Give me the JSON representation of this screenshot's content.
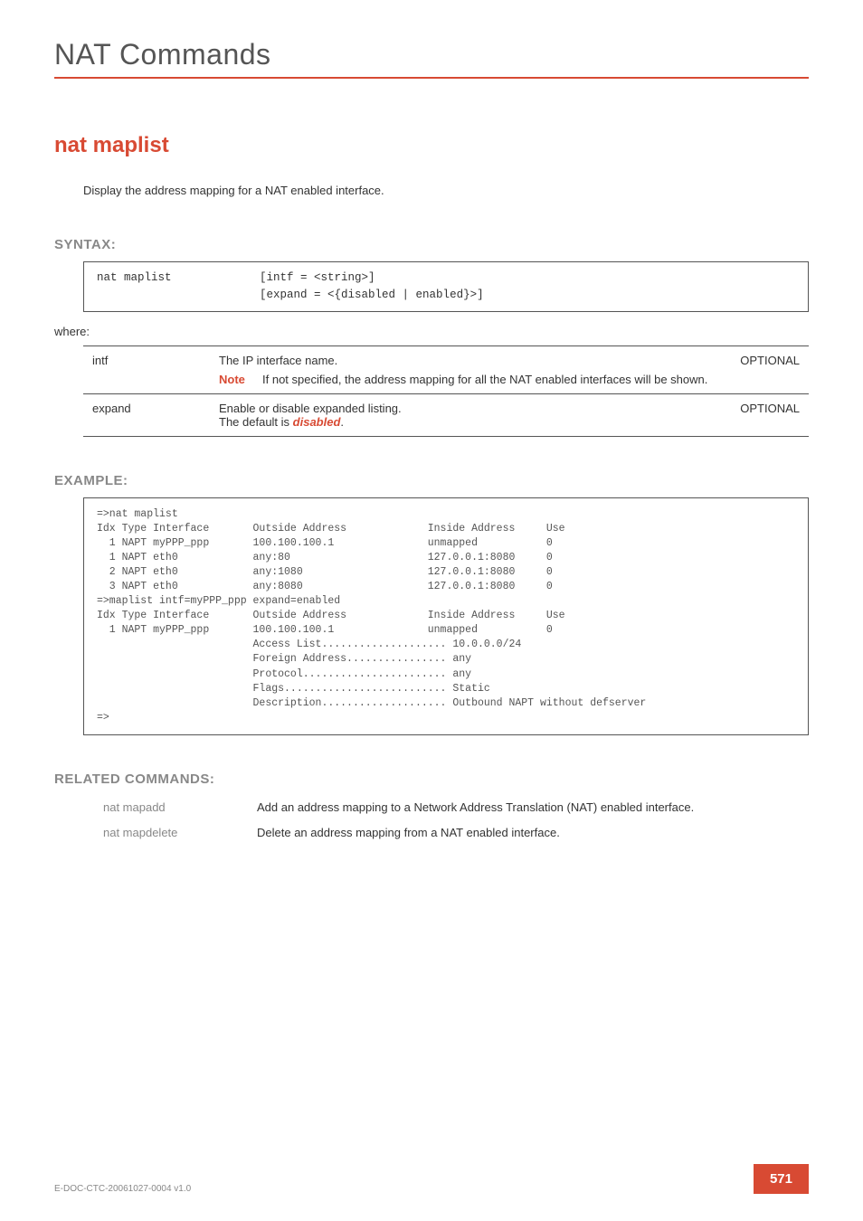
{
  "page_title": "NAT Commands",
  "command_title": "nat maplist",
  "description": "Display the address mapping for a NAT enabled interface.",
  "syntax": {
    "label": "SYNTAX:",
    "lines": "nat maplist             [intf = <string>]\n                        [expand = <{disabled | enabled}>]",
    "where": "where:",
    "params": [
      {
        "name": "intf",
        "desc_line1": "The IP interface name.",
        "note_label": "Note",
        "note_text": "If not specified, the address mapping for all the NAT enabled interfaces will be shown.",
        "flag": "OPTIONAL"
      },
      {
        "name": "expand",
        "desc_line1": "Enable or disable expanded listing.",
        "default_prefix": "The default is ",
        "default_value": "disabled",
        "default_suffix": ".",
        "flag": "OPTIONAL"
      }
    ]
  },
  "example": {
    "label": "EXAMPLE:",
    "text": "=>nat maplist\nIdx Type Interface       Outside Address             Inside Address     Use\n  1 NAPT myPPP_ppp       100.100.100.1               unmapped           0\n  1 NAPT eth0            any:80                      127.0.0.1:8080     0\n  2 NAPT eth0            any:1080                    127.0.0.1:8080     0\n  3 NAPT eth0            any:8080                    127.0.0.1:8080     0\n=>maplist intf=myPPP_ppp expand=enabled\nIdx Type Interface       Outside Address             Inside Address     Use\n  1 NAPT myPPP_ppp       100.100.100.1               unmapped           0\n                         Access List.................... 10.0.0.0/24\n                         Foreign Address................ any\n                         Protocol....................... any\n                         Flags.......................... Static\n                         Description.................... Outbound NAPT without defserver\n=>"
  },
  "related": {
    "label": "RELATED COMMANDS:",
    "items": [
      {
        "name": "nat mapadd",
        "desc": "Add an address mapping to a Network Address Translation (NAT) enabled interface."
      },
      {
        "name": "nat mapdelete",
        "desc": "Delete an address mapping from a NAT enabled interface."
      }
    ]
  },
  "footer": {
    "docid": "E-DOC-CTC-20061027-0004 v1.0",
    "page": "571"
  }
}
